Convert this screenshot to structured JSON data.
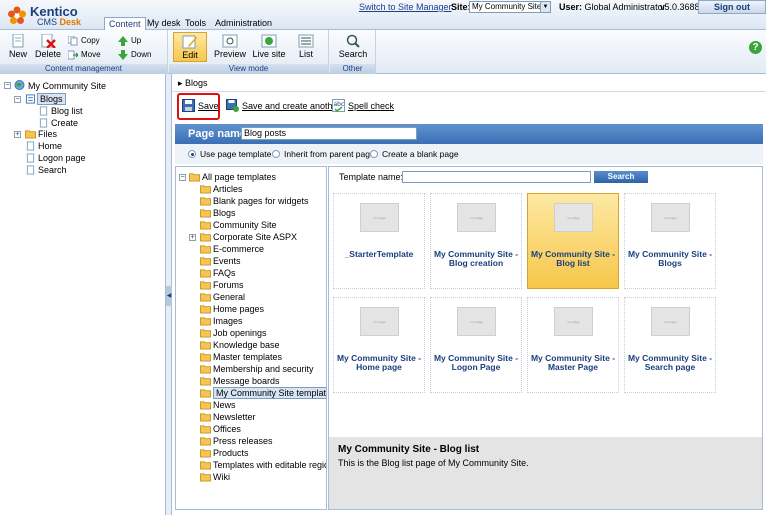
{
  "header": {
    "brand": "Kentico",
    "product_prefix": "CMS ",
    "product_name": "Desk",
    "tabs": [
      {
        "label": "Content"
      },
      {
        "label": "My desk"
      },
      {
        "label": "Tools"
      },
      {
        "label": "Administration"
      }
    ],
    "switch_link": "Switch to Site Manager",
    "site_label": "Site:",
    "site_value": "My Community Site",
    "user_label": "User:",
    "user_value": "Global Administrator",
    "version": "v5.0.3688",
    "signout": "Sign out"
  },
  "toolbar": {
    "content_management": {
      "label": "Content management",
      "new": "New",
      "delete": "Delete",
      "copy": "Copy",
      "move": "Move",
      "up": "Up",
      "down": "Down"
    },
    "view_mode": {
      "label": "View mode",
      "edit": "Edit",
      "preview": "Preview",
      "live_site": "Live site",
      "list": "List"
    },
    "other": {
      "label": "Other",
      "search": "Search"
    }
  },
  "content_tree": {
    "root": "My Community Site",
    "blogs": "Blogs",
    "blog_list": "Blog list",
    "create": "Create",
    "files": "Files",
    "home": "Home",
    "logon_page": "Logon page",
    "search": "Search"
  },
  "breadcrumb": "Blogs",
  "actions": {
    "save": "Save",
    "save_create": "Save and create another",
    "spell": "Spell check"
  },
  "page_name": {
    "label": "Page name:",
    "value": "Blog posts"
  },
  "radio_options": {
    "use_template": "Use page template",
    "inherit": "Inherit from parent page",
    "blank": "Create a blank page"
  },
  "template_tree": {
    "root": "All page templates",
    "items": [
      "Articles",
      "Blank pages for widgets",
      "Blogs",
      "Community Site",
      "Corporate Site ASPX",
      "E-commerce",
      "Events",
      "FAQs",
      "Forums",
      "General",
      "Home pages",
      "Images",
      "Job openings",
      "Knowledge base",
      "Master templates",
      "Membership and security",
      "Message boards",
      "My Community Site templates",
      "News",
      "Newsletter",
      "Offices",
      "Press releases",
      "Products",
      "Templates with editable regio",
      "Wiki"
    ]
  },
  "template_search": {
    "label": "Template name:",
    "button": "Search"
  },
  "templates": [
    {
      "name": "_StarterTemplate",
      "thumb": "no image"
    },
    {
      "name": "My Community Site - Blog creation",
      "thumb": "no image"
    },
    {
      "name": "My Community Site - Blog list",
      "thumb": "no image"
    },
    {
      "name": "My Community Site - Blogs",
      "thumb": "no image"
    },
    {
      "name": "My Community Site - Home page",
      "thumb": "no image"
    },
    {
      "name": "My Community Site - Logon Page",
      "thumb": "no image"
    },
    {
      "name": "My Community Site - Master Page",
      "thumb": "no image"
    },
    {
      "name": "My Community Site - Search page",
      "thumb": "no image"
    }
  ],
  "description": {
    "title": "My Community Site - Blog list",
    "text": "This is the Blog list page of My Community Site."
  },
  "colors": {
    "accent": "#3a6fb4",
    "selection": "#f7c64a",
    "highlight": "#e01010"
  }
}
